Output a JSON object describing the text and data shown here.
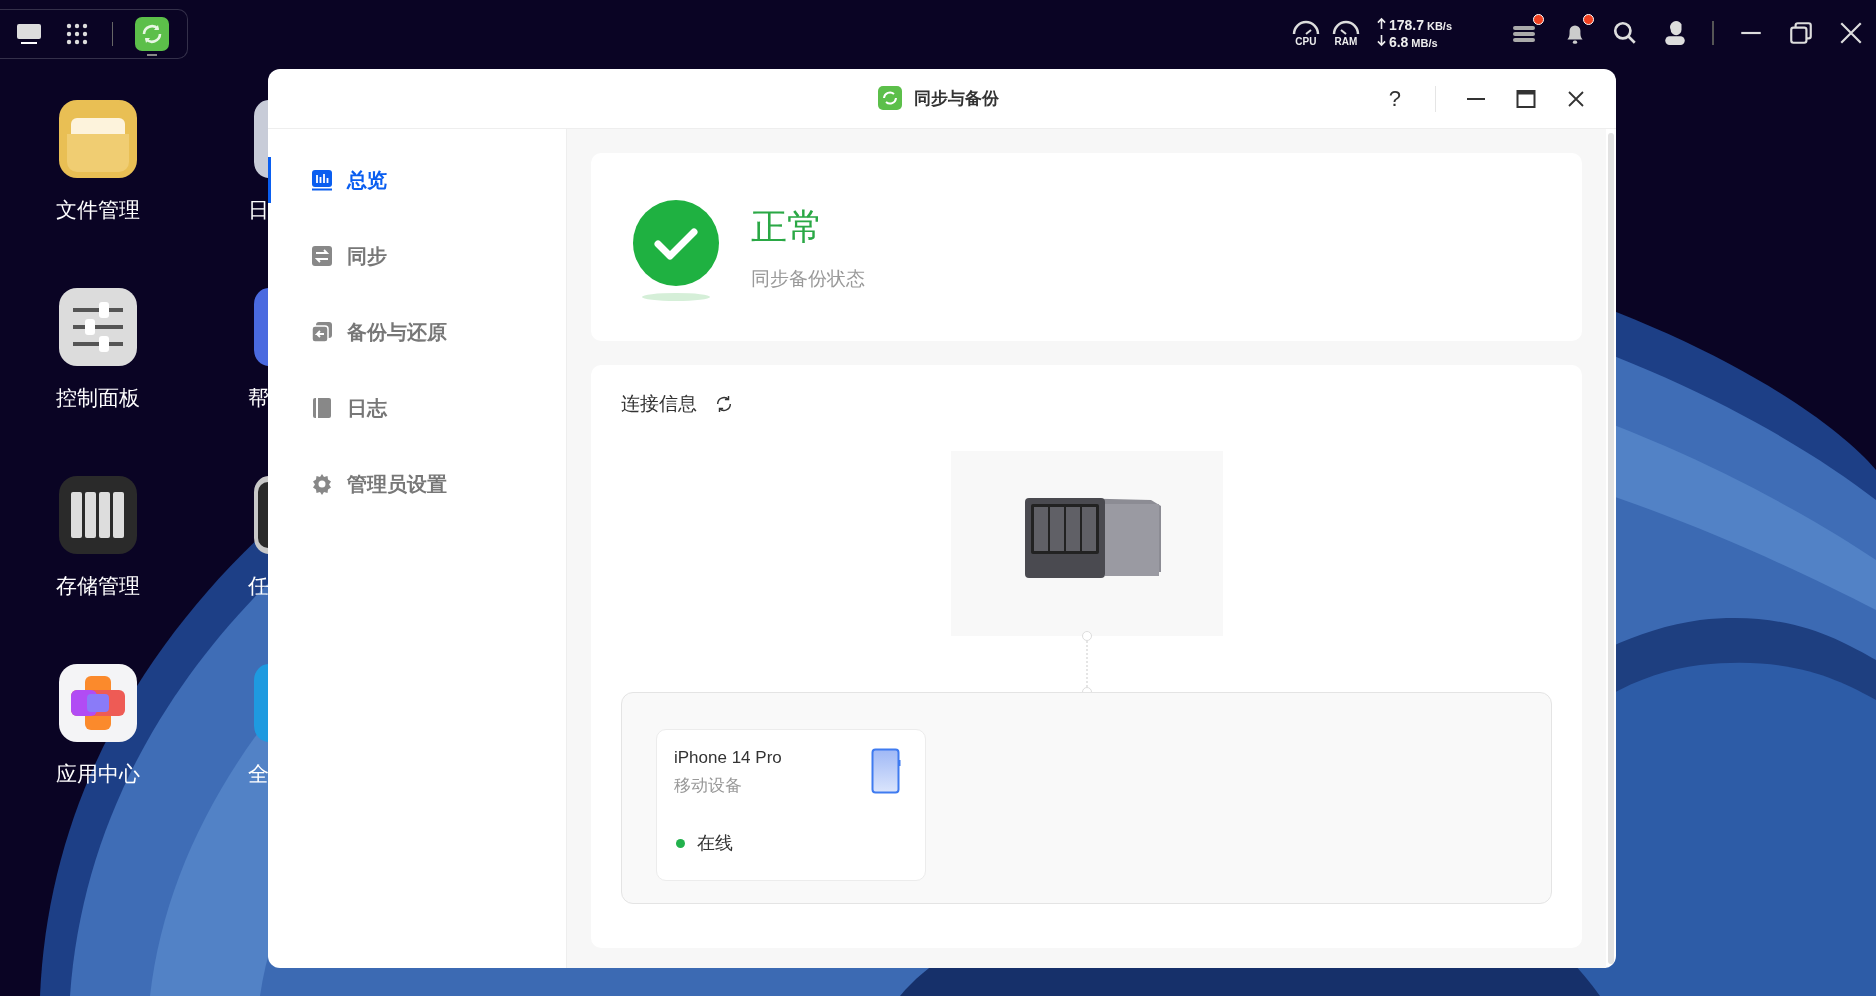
{
  "system_tray": {
    "cpu_label": "CPU",
    "ram_label": "RAM",
    "upload": {
      "value": "178.7",
      "unit": "KB/s"
    },
    "download": {
      "value": "6.8",
      "unit": "MB/s"
    },
    "tasks_badge": true,
    "notifications_badge": true
  },
  "desktop": {
    "icons": [
      {
        "label": "文件管理",
        "kind": "folder"
      },
      {
        "label": "控制面板",
        "kind": "sliders"
      },
      {
        "label": "存储管理",
        "kind": "storage"
      },
      {
        "label": "应用中心",
        "kind": "apps"
      }
    ],
    "partial_icons": [
      {
        "label": "日",
        "kind": "calendar"
      },
      {
        "label": "帮",
        "kind": "help"
      },
      {
        "label": "任",
        "kind": "monitor"
      },
      {
        "label": "全",
        "kind": "globe"
      }
    ]
  },
  "window": {
    "title": "同步与备份",
    "help": "?"
  },
  "sidebar": {
    "items": [
      {
        "label": "总览",
        "kind": "overview",
        "selected": true
      },
      {
        "label": "同步",
        "kind": "sync",
        "selected": false
      },
      {
        "label": "备份与还原",
        "kind": "backup",
        "selected": false
      },
      {
        "label": "日志",
        "kind": "log",
        "selected": false
      },
      {
        "label": "管理员设置",
        "kind": "settings",
        "selected": false
      }
    ]
  },
  "status": {
    "title": "正常",
    "subtitle": "同步备份状态"
  },
  "connection": {
    "title": "连接信息",
    "devices": [
      {
        "name": "iPhone 14 Pro",
        "type": "移动设备",
        "status": "在线",
        "color": "#22b14c"
      }
    ]
  }
}
